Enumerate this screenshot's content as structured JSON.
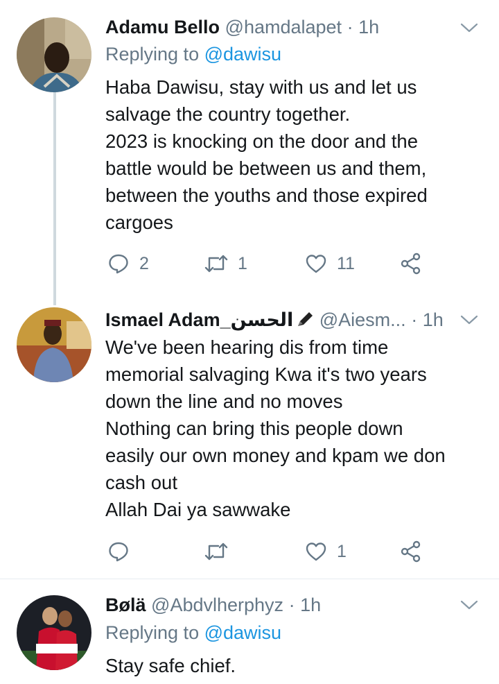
{
  "tweets": [
    {
      "name": "Adamu Bello",
      "handle": "@hamdalapet",
      "dot": "·",
      "time": "1h",
      "replying_prefix": "Replying to",
      "replying_to": "@dawisu",
      "lines": [
        "Haba Dawisu, stay with us and let us",
        "salvage the country together.",
        "2023 is knocking on the door and the",
        "battle would be between us and them,",
        "between the youths and those  expired",
        "cargoes"
      ],
      "reply_count": "2",
      "retweet_count": "1",
      "like_count": "11"
    },
    {
      "name": "Ismael Adam_الحسن",
      "name_emoji": "pencil-emoji",
      "handle": "@Aiesm...",
      "dot": "·",
      "time": "1h",
      "lines": [
        "We've been hearing dis from time",
        "memorial salvaging Kwa it's two years",
        "down the line and no moves",
        "Nothing can bring this people down",
        "easily our own money and kpam we don",
        "cash out",
        "Allah Dai ya sawwake"
      ],
      "reply_count": "",
      "retweet_count": "",
      "like_count": "1"
    },
    {
      "name": "Bølä",
      "handle": "@Abdvlherphyz",
      "dot": "·",
      "time": "1h",
      "replying_prefix": "Replying to",
      "replying_to": "@dawisu",
      "lines": [
        "Stay safe chief."
      ]
    }
  ],
  "colors": {
    "text": "#14171a",
    "muted": "#657786",
    "link": "#1b95e0",
    "thread_line": "#cfd9de",
    "divider": "#e6ecf0"
  },
  "icons": [
    "reply-icon",
    "retweet-icon",
    "like-icon",
    "share-icon",
    "chevron-down-icon"
  ]
}
